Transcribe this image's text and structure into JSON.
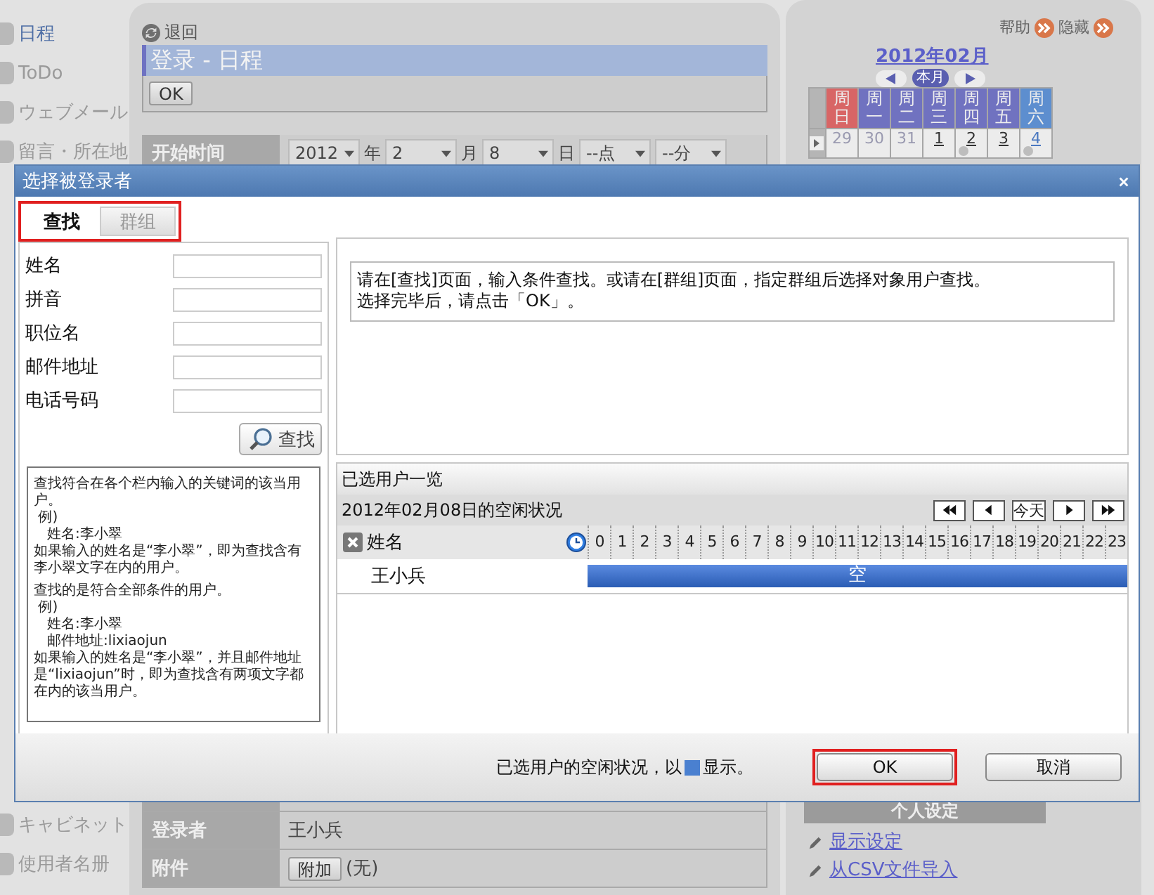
{
  "sidebar": {
    "top_items": [
      {
        "label": "日程",
        "selected": true
      },
      {
        "label": "ToDo",
        "selected": false
      },
      {
        "label": "ウェブメール",
        "selected": false
      },
      {
        "label": "留言・所在地",
        "selected": false
      }
    ],
    "bottom_items": [
      {
        "label": "キャビネット",
        "selected": false
      },
      {
        "label": "使用者名册",
        "selected": false
      }
    ]
  },
  "main": {
    "back": "退回",
    "title": "登录 - 日程",
    "ok": "OK",
    "start_time": {
      "label": "开始时间",
      "fields": [
        {
          "value": "2012",
          "unit": "年"
        },
        {
          "value": "2",
          "unit": "月"
        },
        {
          "value": "8",
          "unit": "日"
        },
        {
          "value": "--点"
        },
        {
          "value": "--分"
        }
      ]
    },
    "bottom_rows": [
      {
        "label": "登录者",
        "value": "王小兵"
      },
      {
        "label": "附件",
        "button": "附加",
        "value": "(无)"
      }
    ]
  },
  "calendar": {
    "help": "帮助",
    "hide": "隐藏",
    "month": "2012年02月",
    "this_month": "本月",
    "weekdays": [
      {
        "label": "周日",
        "kind": "sunday"
      },
      {
        "label": "周一",
        "kind": "weekday"
      },
      {
        "label": "周二",
        "kind": "weekday"
      },
      {
        "label": "周三",
        "kind": "weekday"
      },
      {
        "label": "周四",
        "kind": "weekday"
      },
      {
        "label": "周五",
        "kind": "weekday"
      },
      {
        "label": "周六",
        "kind": "saturday"
      }
    ],
    "days": [
      {
        "label": "29",
        "kind": "other",
        "has_event": false
      },
      {
        "label": "30",
        "kind": "other",
        "has_event": false
      },
      {
        "label": "31",
        "kind": "other",
        "has_event": false
      },
      {
        "label": "1",
        "kind": "current",
        "has_event": false
      },
      {
        "label": "2",
        "kind": "current",
        "has_event": true
      },
      {
        "label": "3",
        "kind": "current",
        "has_event": false
      },
      {
        "label": "4",
        "kind": "saturday",
        "has_event": true
      }
    ]
  },
  "personal": {
    "title": "个人设定",
    "links": [
      "显示设定",
      "从CSV文件导入"
    ]
  },
  "dialog": {
    "title": "选择被登录者",
    "tabs_highlighted": true,
    "tabs": [
      {
        "label": "查找",
        "selected": true
      },
      {
        "label": "群组",
        "selected": false
      }
    ],
    "fields": [
      {
        "label": "姓名"
      },
      {
        "label": "拼音"
      },
      {
        "label": "职位名"
      },
      {
        "label": "邮件地址"
      },
      {
        "label": "电话号码"
      }
    ],
    "search_button": "查找",
    "help_lines": [
      "查找符合在各个栏内输入的关键词的该当用户。",
      " 例)",
      "   姓名:李小翠",
      "如果输入的姓名是“李小翠”，即为查找含有李小翠文字在内的用户。",
      "查找的是符合全部条件的用户。",
      " 例)",
      "   姓名:李小翠",
      "   邮件地址:lixiaojun",
      "如果输入的姓名是“李小翠”，并且邮件地址是“lixiaojun”时，即为查找含有两项文字都在内的该当用户。"
    ],
    "info_lines": [
      "请在[查找]页面，输入条件查找。或请在[群组]页面，指定群组后选择对象用户查找。",
      "选择完毕后，请点击「OK」。"
    ],
    "selected_header": "已选用户一览",
    "date_label": "2012年02月08日的空闲状况",
    "today": "今天",
    "name_header": "姓名",
    "hours": [
      "0",
      "1",
      "2",
      "3",
      "4",
      "5",
      "6",
      "7",
      "8",
      "9",
      "10",
      "11",
      "12",
      "13",
      "14",
      "15",
      "16",
      "17",
      "18",
      "19",
      "20",
      "21",
      "22",
      "23"
    ],
    "rows": [
      {
        "name": "王小兵",
        "status": "空"
      }
    ],
    "note_before": "已选用户的空闲状况，以",
    "note_after": "显示。",
    "ok": "OK",
    "ok_highlighted": true,
    "cancel": "取消"
  }
}
